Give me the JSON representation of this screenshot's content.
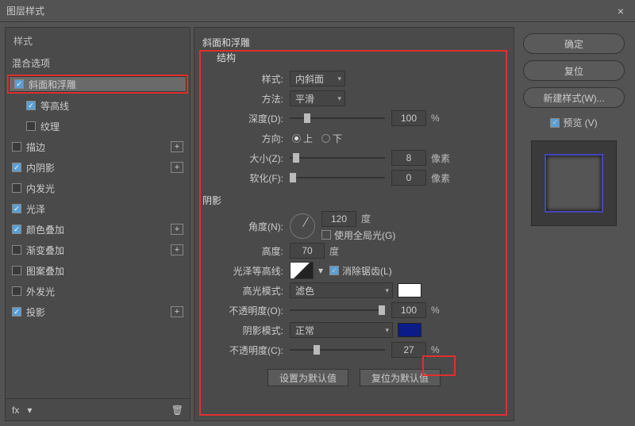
{
  "window": {
    "title": "图层样式",
    "close": "×"
  },
  "left": {
    "header": "样式",
    "blend": "混合选项",
    "items": [
      {
        "label": "斜面和浮雕",
        "checked": true,
        "selected": true,
        "hilite": true
      },
      {
        "label": "等高线",
        "checked": true,
        "indent": true
      },
      {
        "label": "纹理",
        "checked": false,
        "indent": true
      },
      {
        "label": "描边",
        "checked": false,
        "add": true
      },
      {
        "label": "内阴影",
        "checked": true,
        "add": true
      },
      {
        "label": "内发光",
        "checked": false
      },
      {
        "label": "光泽",
        "checked": true
      },
      {
        "label": "颜色叠加",
        "checked": true,
        "add": true
      },
      {
        "label": "渐变叠加",
        "checked": false,
        "add": true
      },
      {
        "label": "图案叠加",
        "checked": false
      },
      {
        "label": "外发光",
        "checked": false
      },
      {
        "label": "投影",
        "checked": true,
        "add": true
      }
    ],
    "fx": "fx",
    "trash": "🗑"
  },
  "mid": {
    "title": "斜面和浮雕",
    "struct": "结构",
    "style": {
      "label": "样式:",
      "value": "内斜面"
    },
    "method": {
      "label": "方法:",
      "value": "平滑"
    },
    "depth": {
      "label": "深度(D):",
      "value": "100",
      "unit": "%"
    },
    "dir": {
      "label": "方向:",
      "up": "上",
      "down": "下"
    },
    "size": {
      "label": "大小(Z):",
      "value": "8",
      "unit": "像素"
    },
    "soften": {
      "label": "软化(F):",
      "value": "0",
      "unit": "像素"
    },
    "shadow": "阴影",
    "angle": {
      "label": "角度(N):",
      "value": "120",
      "unit": "度"
    },
    "global": {
      "label": "使用全局光(G)"
    },
    "alt": {
      "label": "高度:",
      "value": "70",
      "unit": "度"
    },
    "gloss": {
      "label": "光泽等高线:",
      "aa": "消除锯齿(L)"
    },
    "hilite": {
      "label": "高光模式:",
      "value": "滤色",
      "color": "#ffffff"
    },
    "hop": {
      "label": "不透明度(O):",
      "value": "100",
      "unit": "%"
    },
    "smode": {
      "label": "阴影模式:",
      "value": "正常",
      "color": "#0b1b8a"
    },
    "sop": {
      "label": "不透明度(C):",
      "value": "27",
      "unit": "%"
    },
    "btn1": "设置为默认值",
    "btn2": "复位为默认值"
  },
  "right": {
    "ok": "确定",
    "reset": "复位",
    "new": "新建样式(W)...",
    "preview": "预览 (V)"
  }
}
